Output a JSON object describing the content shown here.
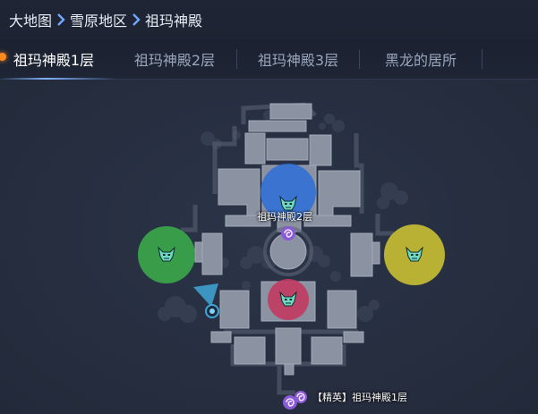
{
  "breadcrumb": {
    "items": [
      "大地图",
      "雪原地区",
      "祖玛神殿"
    ]
  },
  "tabs": [
    {
      "label": "祖玛神殿1层",
      "active": true
    },
    {
      "label": "祖玛神殿2层",
      "active": false
    },
    {
      "label": "祖玛神殿3层",
      "active": false
    },
    {
      "label": "黑龙的居所",
      "active": false
    }
  ],
  "map": {
    "portal_up_label": "祖玛神殿2层",
    "portal_elite_label": "【精英】祖玛神殿1层",
    "boss_zones": [
      {
        "color": "#2f6fd6",
        "icon": "demon-head-icon"
      },
      {
        "color": "#3aa84a",
        "icon": "demon-head-icon"
      },
      {
        "color": "#c9c033",
        "icon": "demon-head-icon"
      },
      {
        "color": "#c23a60",
        "icon": "demon-head-icon"
      }
    ],
    "colors": {
      "active_tab_dot": "#ff8a1e",
      "player_marker": "#3fa7d6",
      "portal": "#8a5ad6"
    }
  }
}
